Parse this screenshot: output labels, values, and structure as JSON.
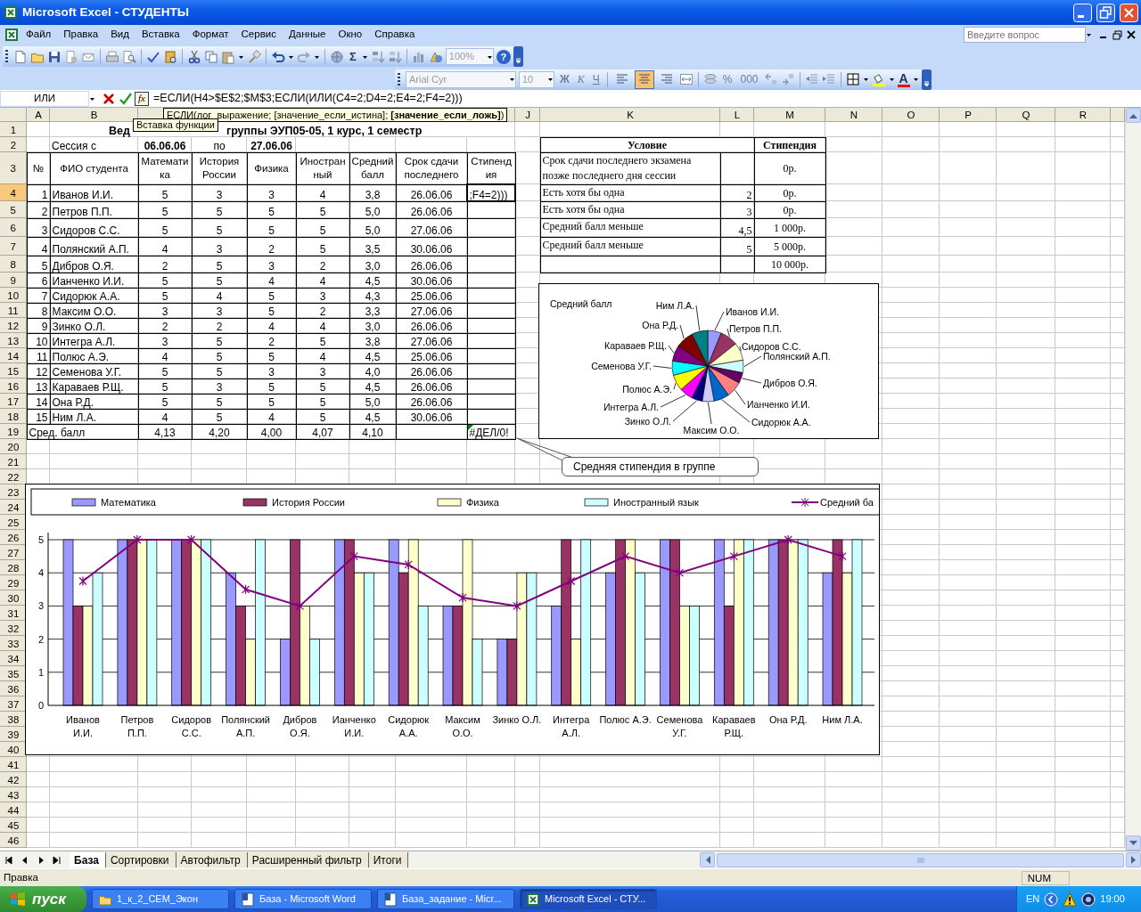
{
  "window": {
    "title": "Microsoft Excel - СТУДЕНТЫ"
  },
  "menu": [
    "Файл",
    "Правка",
    "Вид",
    "Вставка",
    "Формат",
    "Сервис",
    "Данные",
    "Окно",
    "Справка"
  ],
  "help_box": {
    "placeholder": "Введите вопрос"
  },
  "standard_toolbar": {
    "autosum": "Σ",
    "zoom": "100%",
    "zoom_disabled": true,
    "help": "?"
  },
  "formatting_toolbar": {
    "font": "Arial Cyr",
    "size": "10",
    "disabled": true,
    "style_buttons": [
      "Ж",
      "К",
      "Ч"
    ],
    "alignment": [
      {
        "selected": false
      },
      {
        "selected": true
      },
      {
        "selected": false
      }
    ],
    "number_buttons": [
      "%",
      "000"
    ],
    "font_color": "A"
  },
  "formula_bar": {
    "name_box": "ИЛИ",
    "function_button": "fx",
    "formula": "=ЕСЛИ(H4>$E$2;$M$3;ЕСЛИ(ИЛИ(C4=2;D4=2;E4=2;F4=2)))",
    "hint": "ЕСЛИ(лог_выражение; [значение_если_истина]; **[значение_если_ложь]**)",
    "tooltip": "Вставка функции"
  },
  "sheet": {
    "column_headers": [
      "A",
      "B",
      "J",
      "K",
      "L",
      "M",
      "N",
      "O",
      "P",
      "Q",
      "R"
    ],
    "row_headers": [
      {
        "label": "1",
        "selected": false
      },
      {
        "label": "2",
        "selected": false
      },
      {
        "label": "3",
        "selected": false
      },
      {
        "label": "4",
        "selected": true
      },
      {
        "label": "5",
        "selected": false
      },
      {
        "label": "6",
        "selected": false
      },
      {
        "label": "7",
        "selected": false
      },
      {
        "label": "8",
        "selected": false
      },
      {
        "label": "9",
        "selected": false
      },
      {
        "label": "10",
        "selected": false
      },
      {
        "label": "11",
        "selected": false
      },
      {
        "label": "12",
        "selected": false
      },
      {
        "label": "13",
        "selected": false
      },
      {
        "label": "14",
        "selected": false
      },
      {
        "label": "15",
        "selected": false
      },
      {
        "label": "16",
        "selected": false
      },
      {
        "label": "17",
        "selected": false
      },
      {
        "label": "18",
        "selected": false
      },
      {
        "label": "19",
        "selected": false
      },
      {
        "label": "20",
        "selected": false
      },
      {
        "label": "21",
        "selected": false
      },
      {
        "label": "22",
        "selected": false
      },
      {
        "label": "23",
        "selected": false
      },
      {
        "label": "24",
        "selected": false
      },
      {
        "label": "25",
        "selected": false
      },
      {
        "label": "26",
        "selected": false
      },
      {
        "label": "27",
        "selected": false
      },
      {
        "label": "28",
        "selected": false
      },
      {
        "label": "29",
        "selected": false
      },
      {
        "label": "30",
        "selected": false
      },
      {
        "label": "31",
        "selected": false
      },
      {
        "label": "32",
        "selected": false
      },
      {
        "label": "33",
        "selected": false
      },
      {
        "label": "34",
        "selected": false
      },
      {
        "label": "35",
        "selected": false
      },
      {
        "label": "36",
        "selected": false
      },
      {
        "label": "37",
        "selected": false
      },
      {
        "label": "38",
        "selected": false
      },
      {
        "label": "39",
        "selected": false
      },
      {
        "label": "40",
        "selected": false
      },
      {
        "label": "41",
        "selected": false
      },
      {
        "label": "42",
        "selected": false
      },
      {
        "label": "43",
        "selected": false
      },
      {
        "label": "44",
        "selected": false
      },
      {
        "label": "45",
        "selected": false
      },
      {
        "label": "46",
        "selected": false
      }
    ],
    "title_parts": [
      "Вед",
      "группы ЭУП05-05, 1 курс, 1 семестр"
    ],
    "session": {
      "label": "Сессия с",
      "start": "06.06.06",
      "to": "по",
      "end": "27.06.06"
    },
    "headers": [
      "№",
      "ФИО студента",
      "Математика",
      "История России",
      "Физика",
      "Иностранный",
      "Средний балл",
      "Срок сдачи последнего",
      "Стипендия"
    ],
    "students": [
      {
        "no": "1",
        "name": "Иванов И.И.",
        "grades": [
          "5",
          "3",
          "3",
          "4"
        ],
        "avg": "3,8",
        "date": "26.06.06",
        "grant": ";F4=2)))"
      },
      {
        "no": "2",
        "name": "Петров П.П.",
        "grades": [
          "5",
          "5",
          "5",
          "5"
        ],
        "avg": "5,0",
        "date": "26.06.06"
      },
      {
        "no": "3",
        "name": "Сидоров С.С.",
        "grades": [
          "5",
          "5",
          "5",
          "5"
        ],
        "avg": "5,0",
        "date": "27.06.06"
      },
      {
        "no": "4",
        "name": "Полянский А.П.",
        "grades": [
          "4",
          "3",
          "2",
          "5"
        ],
        "avg": "3,5",
        "date": "30.06.06"
      },
      {
        "no": "5",
        "name": "Дибров О.Я.",
        "grades": [
          "2",
          "5",
          "3",
          "2"
        ],
        "avg": "3,0",
        "date": "26.06.06"
      },
      {
        "no": "6",
        "name": "Ианченко И.И.",
        "grades": [
          "5",
          "5",
          "4",
          "4"
        ],
        "avg": "4,5",
        "date": "30.06.06"
      },
      {
        "no": "7",
        "name": "Сидорюк А.А.",
        "grades": [
          "5",
          "4",
          "5",
          "3"
        ],
        "avg": "4,3",
        "date": "25.06.06"
      },
      {
        "no": "8",
        "name": "Максим О.О.",
        "grades": [
          "3",
          "3",
          "5",
          "2"
        ],
        "avg": "3,3",
        "date": "27.06.06"
      },
      {
        "no": "9",
        "name": "Зинко О.Л.",
        "grades": [
          "2",
          "2",
          "4",
          "4"
        ],
        "avg": "3,0",
        "date": "26.06.06"
      },
      {
        "no": "10",
        "name": "Интегра А.Л.",
        "grades": [
          "3",
          "5",
          "2",
          "5"
        ],
        "avg": "3,8",
        "date": "27.06.06"
      },
      {
        "no": "11",
        "name": "Полюс А.Э.",
        "grades": [
          "4",
          "5",
          "5",
          "4"
        ],
        "avg": "4,5",
        "date": "25.06.06"
      },
      {
        "no": "12",
        "name": "Семенова У.Г.",
        "grades": [
          "5",
          "5",
          "3",
          "3"
        ],
        "avg": "4,0",
        "date": "26.06.06"
      },
      {
        "no": "13",
        "name": "Караваев Р.Щ.",
        "grades": [
          "5",
          "3",
          "5",
          "5"
        ],
        "avg": "4,5",
        "date": "26.06.06"
      },
      {
        "no": "14",
        "name": "Она Р.Д.",
        "grades": [
          "5",
          "5",
          "5",
          "5"
        ],
        "avg": "5,0",
        "date": "26.06.06"
      },
      {
        "no": "15",
        "name": "Ним Л.А.",
        "grades": [
          "4",
          "5",
          "4",
          "5"
        ],
        "avg": "4,5",
        "date": "30.06.06"
      }
    ],
    "footer": {
      "label": "Сред. балл",
      "values": [
        "4,13",
        "4,20",
        "4,00",
        "4,07",
        "4,10"
      ],
      "grant": "#ДЕЛ/0!"
    },
    "conditions": {
      "headers": [
        "Условие",
        "Стипендия"
      ],
      "rows": [
        {
          "condition": "Срок сдачи последнего экзамена позже последнего дня сессии",
          "value": "0р."
        },
        {
          "condition": "Есть хотя бы одна",
          "threshold": "2",
          "value": "0р."
        },
        {
          "condition": "Есть хотя бы одна",
          "threshold": "3",
          "value": "0р."
        },
        {
          "condition": "Средний балл меньше",
          "threshold": "4,5",
          "value": "1 000р."
        },
        {
          "condition": "Средний балл меньше",
          "threshold": "5",
          "value": "5 000р."
        },
        {
          "value": "10 000р."
        }
      ]
    }
  },
  "pie_chart": {
    "title": "Средний балл",
    "labels": [
      "Ним Л.А.",
      "Она Р.Д.",
      "Караваев Р.Щ.",
      "Семенова У.Г.",
      "Полюс А.Э.",
      "Интегра А.Л.",
      "Зинко О.Л.",
      "Иванов И.И.",
      "Петров П.П.",
      "Сидоров С.С.",
      "Полянский А.П.",
      "Дибров О.Я.",
      "Ианченко И.И.",
      "Сидорюк А.А.",
      "Максим О.О."
    ]
  },
  "callout": "Средняя стипендия в группе",
  "bar_chart": {
    "chart_data": {
      "type": "bar",
      "categories": [
        "Иванов И.И.",
        "Петров П.П.",
        "Сидоров С.С.",
        "Полянский А.П.",
        "Дибров О.Я.",
        "Ианченко И.И.",
        "Сидорюк А.А.",
        "Максим О.О.",
        "Зинко О.Л.",
        "Интегра А.Л.",
        "Полюс А.Э.",
        "Семенова У.Г.",
        "Караваев Р.Щ.",
        "Она Р.Д.",
        "Ним Л.А."
      ],
      "series": [
        {
          "name": "Математика",
          "color": "#9999ff",
          "values": [
            5,
            5,
            5,
            4,
            2,
            5,
            5,
            3,
            2,
            3,
            4,
            5,
            5,
            5,
            4
          ]
        },
        {
          "name": "История России",
          "color": "#993366",
          "values": [
            3,
            5,
            5,
            3,
            5,
            5,
            4,
            3,
            2,
            5,
            5,
            5,
            3,
            5,
            5
          ]
        },
        {
          "name": "Физика",
          "color": "#ffffcc",
          "values": [
            3,
            5,
            5,
            2,
            3,
            4,
            5,
            5,
            4,
            2,
            5,
            3,
            5,
            5,
            4
          ]
        },
        {
          "name": "Иностранный язык",
          "color": "#ccffff",
          "values": [
            4,
            5,
            5,
            5,
            2,
            4,
            3,
            2,
            4,
            5,
            4,
            3,
            5,
            5,
            5
          ]
        },
        {
          "name": "Средний ба",
          "color": "#800080",
          "type": "line",
          "marker": "cross",
          "values": [
            3.75,
            5,
            5,
            3.5,
            3,
            4.5,
            4.25,
            3.25,
            3,
            3.75,
            4.5,
            4,
            4.5,
            5,
            4.5
          ]
        }
      ],
      "ylim": [
        0,
        5
      ],
      "yticks": [
        0,
        1,
        2,
        3,
        4,
        5
      ],
      "grid": true,
      "legend": "top"
    }
  },
  "sheet_tabs": [
    {
      "label": "База",
      "selected": true
    },
    {
      "label": "Сортировки",
      "selected": false
    },
    {
      "label": "Автофильтр",
      "selected": false
    },
    {
      "label": "Расширенный фильтр",
      "selected": false
    },
    {
      "label": "Итоги",
      "selected": false
    }
  ],
  "status_bar": {
    "mode": "Правка",
    "indicator": "NUM"
  },
  "taskbar": {
    "start": "пуск",
    "tasks": [
      {
        "label": "1_к_2_СЕМ_Экон",
        "kind": "folder",
        "selected": false
      },
      {
        "label": "База - Microsoft Word",
        "kind": "word",
        "selected": false
      },
      {
        "label": "База_задание - Micr...",
        "kind": "word",
        "selected": false
      },
      {
        "label": "Microsoft Excel - СТУ...",
        "kind": "excel",
        "selected": true
      }
    ],
    "language": "EN",
    "clock": "19:00"
  }
}
